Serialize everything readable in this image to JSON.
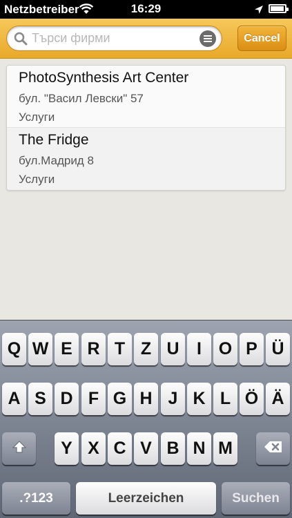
{
  "status_bar": {
    "carrier": "Netzbetreiber",
    "time": "16:29",
    "battery_level": 0.95
  },
  "search": {
    "placeholder": "Търси фирми",
    "value": "",
    "cancel_label": "Cancel"
  },
  "results": [
    {
      "name": "PhotoSynthesis Art Center",
      "address": "бул. \"Васил Левски\" 57",
      "category": "Услуги"
    },
    {
      "name": "The Fridge",
      "address": "бул.Мадрид 8",
      "category": "Услуги"
    }
  ],
  "keyboard": {
    "row1": [
      "Q",
      "W",
      "E",
      "R",
      "T",
      "Z",
      "U",
      "I",
      "O",
      "P",
      "Ü"
    ],
    "row2": [
      "A",
      "S",
      "D",
      "F",
      "G",
      "H",
      "J",
      "K",
      "L",
      "Ö",
      "Ä"
    ],
    "row3": [
      "Y",
      "X",
      "C",
      "V",
      "B",
      "N",
      "M"
    ],
    "numbers_label": ".?123",
    "space_label": "Leerzeichen",
    "search_label": "Suchen"
  },
  "icons": {
    "wifi": "wifi-icon",
    "location": "location-arrow-icon",
    "battery": "battery-icon",
    "search": "search-icon",
    "list": "list-icon",
    "shift": "shift-icon",
    "backspace": "backspace-icon"
  },
  "colors": {
    "accent": "#f0b43c",
    "cancel_button": "#e39c1c"
  }
}
